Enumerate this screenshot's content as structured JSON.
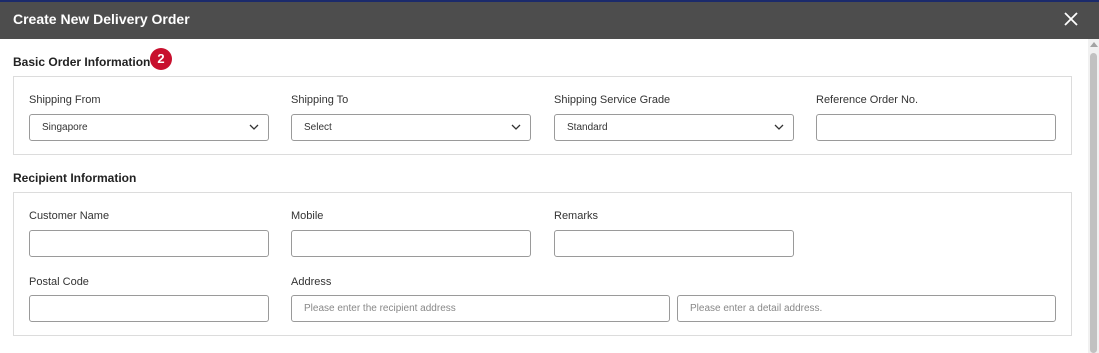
{
  "dialog": {
    "title": "Create New Delivery Order",
    "close_icon": "close-icon"
  },
  "basic_order": {
    "title": "Basic Order Information",
    "step_badge": "2",
    "shipping_from": {
      "label": "Shipping From",
      "value": "Singapore"
    },
    "shipping_to": {
      "label": "Shipping To",
      "value": "Select"
    },
    "service_grade": {
      "label": "Shipping Service Grade",
      "value": "Standard"
    },
    "reference_no": {
      "label": "Reference Order No.",
      "value": ""
    }
  },
  "recipient": {
    "title": "Recipient Information",
    "customer_name": {
      "label": "Customer Name",
      "value": ""
    },
    "mobile": {
      "label": "Mobile",
      "value": ""
    },
    "remarks": {
      "label": "Remarks",
      "value": ""
    },
    "postal_code": {
      "label": "Postal Code",
      "value": ""
    },
    "address": {
      "label": "Address",
      "placeholder": "Please enter the recipient address",
      "detail_placeholder": "Please enter a detail address."
    }
  },
  "colors": {
    "header_bg": "#4d4d4d",
    "badge": "#c8102e"
  }
}
